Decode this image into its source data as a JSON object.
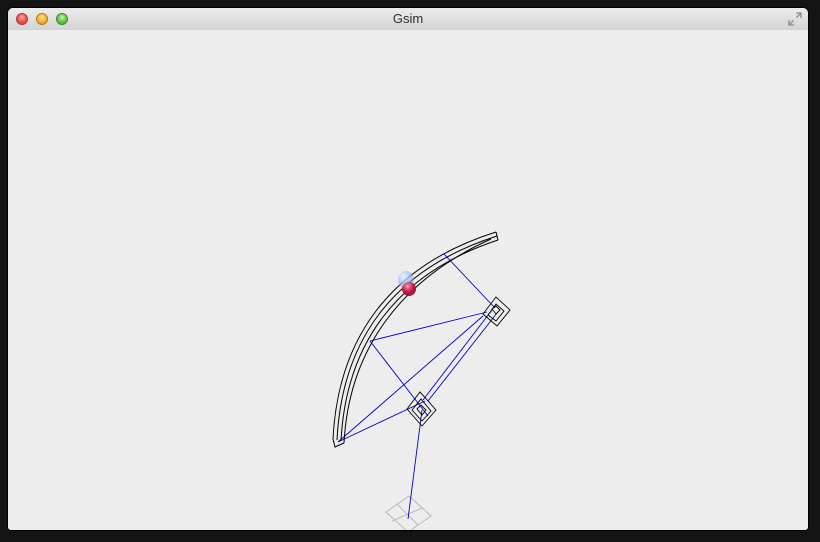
{
  "window": {
    "title": "Gsim"
  },
  "icons": {
    "close": "close-icon",
    "minimize": "minimize-icon",
    "zoom": "zoom-icon",
    "fullscreen": "fullscreen-icon"
  },
  "colors": {
    "window_bg": "#ededed",
    "structure_line": "#000000",
    "tether_line": "#0000c8",
    "ghost_line": "#b9b9b9",
    "ball_red": "#c2123c",
    "ball_blue": "#8fb5f4"
  }
}
